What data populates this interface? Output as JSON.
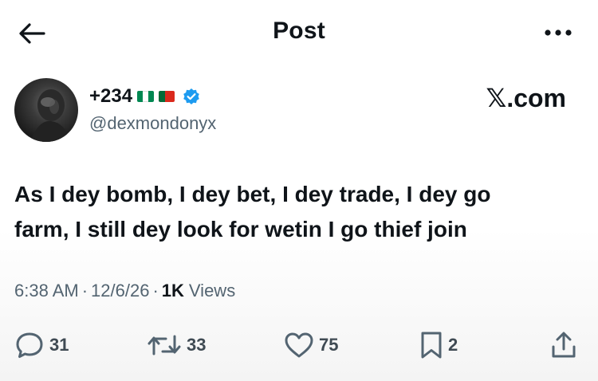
{
  "header": {
    "title": "Post",
    "back_icon": "arrow-left-icon",
    "more_icon": "more-horizontal-icon"
  },
  "author": {
    "display_name": "+234",
    "flags": [
      "nigeria-flag",
      "portugal-flag"
    ],
    "verified": true,
    "handle": "@dexmondonyx",
    "avatar": "avatar"
  },
  "watermark": "𝕏.com",
  "tweet": {
    "text_line1": "As I dey bomb, I dey bet, I dey trade, I dey go",
    "text_line2": "farm, I still dey look for wetin I go thief join"
  },
  "meta": {
    "time": "6:38 AM",
    "date": "12/6/26",
    "separator": "·",
    "views_count": "1K",
    "views_label": "Views"
  },
  "actions": {
    "replies": "31",
    "reposts": "33",
    "likes": "75",
    "bookmarks": "2"
  },
  "colors": {
    "text": "#0f1419",
    "secondary": "#536471",
    "verified": "#1d9bf0"
  }
}
